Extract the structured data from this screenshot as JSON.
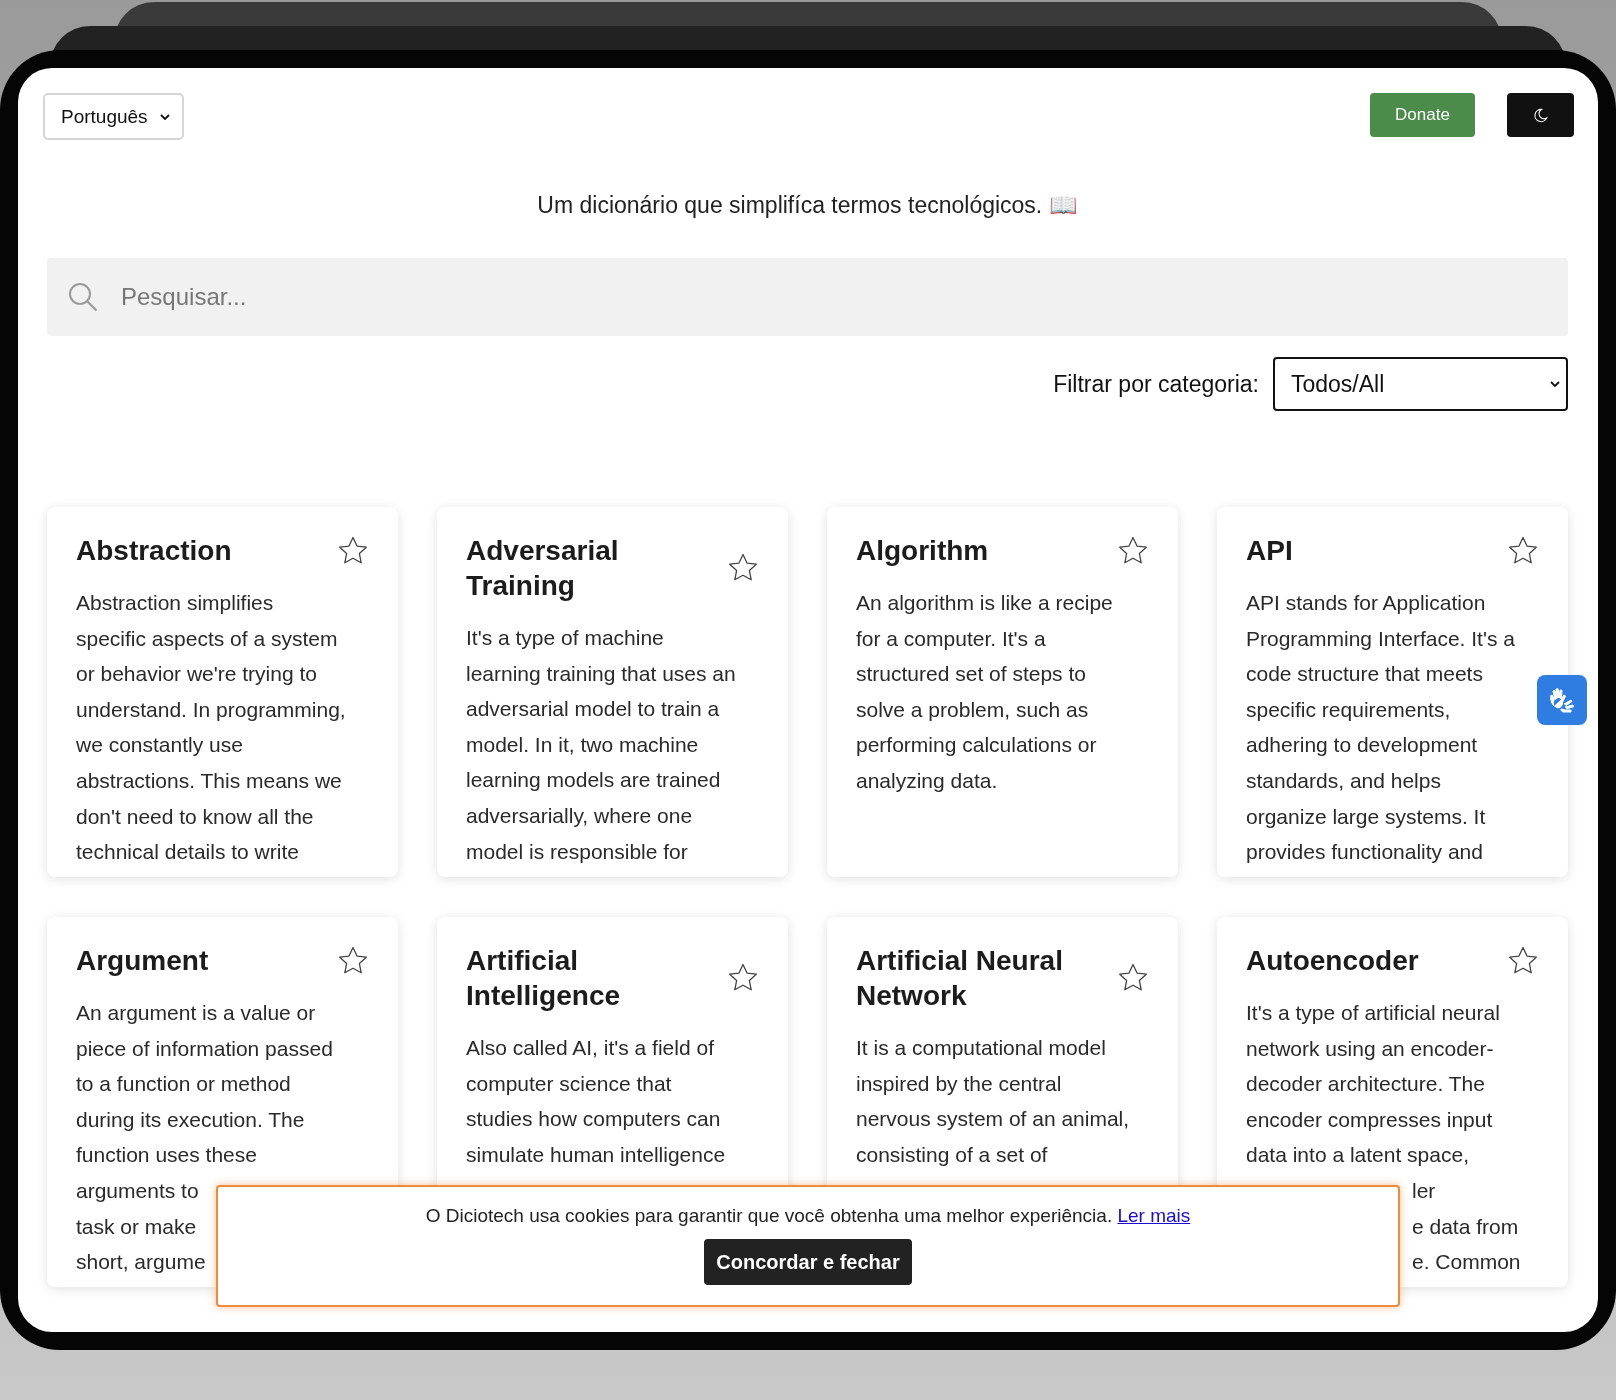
{
  "header": {
    "language": {
      "value": "Português"
    },
    "donate_button": "Donate",
    "theme_button": {
      "dark": true
    }
  },
  "tagline": "Um dicionário que simplifíca termos tecnológicos. 📖",
  "search": {
    "placeholder": "Pesquisar..."
  },
  "filter": {
    "label": "Filtrar por categoria:",
    "value": "Todos/All"
  },
  "cards": [
    {
      "title": "Abstraction",
      "favorite": false,
      "lines": [
        "Abstraction simplifies",
        "specific aspects of a system",
        "or behavior we're trying to",
        "understand. In programming,",
        "we constantly use",
        "abstractions. This means we",
        "don't need to know all the",
        "technical details to write"
      ]
    },
    {
      "title": "Adversarial Training",
      "favorite": false,
      "lines": [
        "It's a type of machine",
        "learning training that uses an",
        "adversarial model to train a",
        "model. In it, two machine",
        "learning models are trained",
        "adversarially, where one",
        "model is responsible for"
      ]
    },
    {
      "title": "Algorithm",
      "favorite": false,
      "lines": [
        "An algorithm is like a recipe",
        "for a computer. It's a",
        "structured set of steps to",
        "solve a problem, such as",
        "performing calculations or",
        "analyzing data."
      ]
    },
    {
      "title": "API",
      "favorite": false,
      "lines": [
        "API stands for Application",
        "Programming Interface. It's a",
        "code structure that meets",
        "specific requirements,",
        "adhering to development",
        "standards, and helps",
        "organize large systems. It",
        "provides functionality and"
      ]
    },
    {
      "title": "Argument",
      "favorite": false,
      "lines": [
        "An argument is a value or",
        "piece of information passed",
        "to a function or method",
        "during its execution. The",
        "function uses these",
        "arguments to",
        "task or make",
        "short, argume"
      ]
    },
    {
      "title": "Artificial Intelligence",
      "favorite": false,
      "lines": [
        "Also called AI, it's a field of",
        "computer science that",
        "studies how computers can",
        "simulate human intelligence"
      ]
    },
    {
      "title": "Artificial Neural Network",
      "favorite": false,
      "lines": [
        "It is a computational model",
        "inspired by the central",
        "nervous system of an animal,",
        "consisting of a set of"
      ]
    },
    {
      "title": "Autoencoder",
      "favorite": false,
      "lines": [
        "It's a type of artificial neural",
        "network using an encoder-",
        "decoder architecture. The",
        "encoder compresses input",
        "data into a latent space,",
        {
          "kind": "tail",
          "text": "ler"
        },
        {
          "kind": "tail",
          "text": "e data from"
        },
        {
          "kind": "tail",
          "text": "e. Common"
        }
      ]
    }
  ],
  "cookie_banner": {
    "message": "O Diciotech usa cookies para garantir que você obtenha uma melhor experiência.",
    "link": "Ler mais",
    "button": "Concordar e fechar"
  }
}
